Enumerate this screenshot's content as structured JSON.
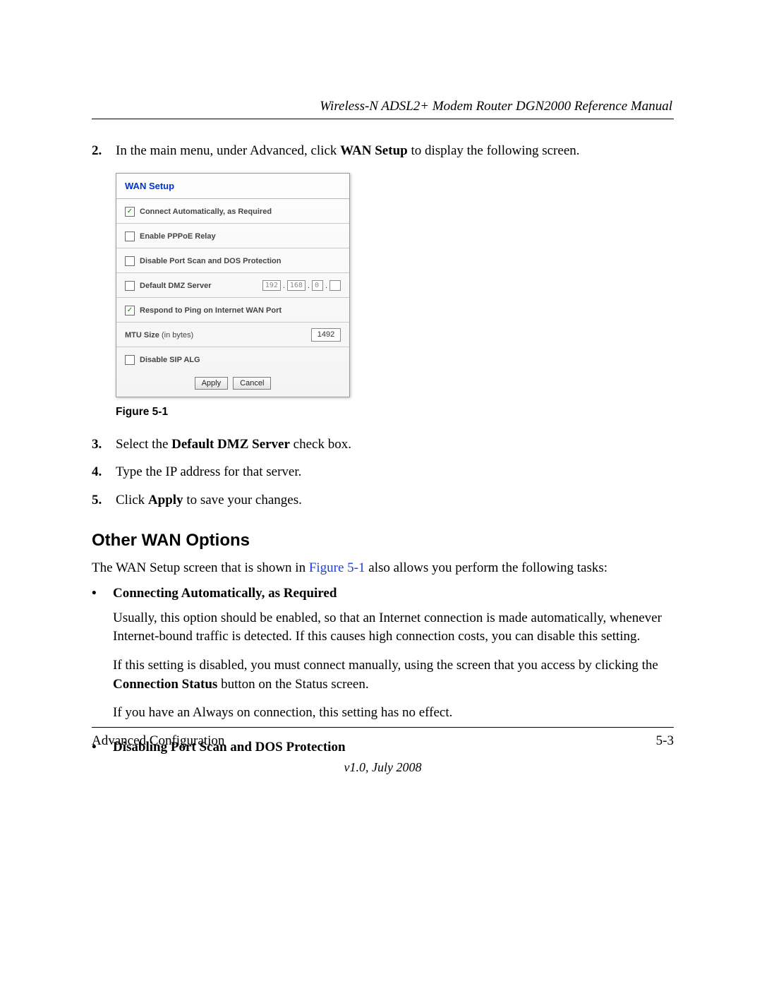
{
  "header": {
    "doc_title": "Wireless-N ADSL2+ Modem Router DGN2000 Reference Manual"
  },
  "steps": {
    "s2": {
      "num": "2.",
      "pre": "In the main menu, under Advanced, click ",
      "bold": "WAN Setup",
      "post": " to display the following screen."
    },
    "s3": {
      "num": "3.",
      "pre": "Select the ",
      "bold": "Default DMZ Server",
      "post": " check box."
    },
    "s4": {
      "num": "4.",
      "text": "Type the IP address for that server."
    },
    "s5": {
      "num": "5.",
      "pre": "Click ",
      "bold": "Apply",
      "post": " to save your changes."
    }
  },
  "screenshot": {
    "title": "WAN Setup",
    "rows": {
      "connect_auto": {
        "label": "Connect Automatically, as Required",
        "checked": true
      },
      "pppoe_relay": {
        "label": "Enable PPPoE Relay",
        "checked": false
      },
      "disable_portscan": {
        "label": "Disable Port Scan and DOS Protection",
        "checked": false
      },
      "dmz": {
        "label": "Default DMZ Server",
        "checked": false,
        "ip": {
          "a": "192",
          "b": "168",
          "c": "0",
          "d": ""
        }
      },
      "respond_ping": {
        "label": "Respond to Ping on Internet WAN Port",
        "checked": true
      },
      "mtu": {
        "label_bold": "MTU Size",
        "label_thin": " (in bytes)",
        "value": "1492"
      },
      "disable_sip": {
        "label": "Disable SIP ALG",
        "checked": false
      }
    },
    "buttons": {
      "apply": "Apply",
      "cancel": "Cancel"
    }
  },
  "caption": "Figure 5-1",
  "section": {
    "heading": "Other WAN Options",
    "intro_pre": "The WAN Setup screen that is shown in ",
    "intro_link": "Figure 5-1",
    "intro_post": " also allows you perform the following tasks:",
    "bullets": {
      "b1": {
        "title": "Connecting Automatically, as Required",
        "p1": "Usually, this option should be enabled, so that an Internet connection is made automatically, whenever Internet-bound traffic is detected. If this causes high connection costs, you can disable this setting.",
        "p2_pre": "If this setting is disabled, you must connect manually, using the screen that you access by clicking the ",
        "p2_bold": "Connection Status",
        "p2_post": " button on the Status screen.",
        "p3": "If you have an Always on connection, this setting has no effect."
      },
      "b2": {
        "title": "Disabling Port Scan and DOS Protection"
      }
    }
  },
  "footer": {
    "left": "Advanced Configuration",
    "right": "5-3",
    "version": "v1.0, July 2008"
  },
  "glyphs": {
    "check": "✓",
    "bullet": "•"
  }
}
